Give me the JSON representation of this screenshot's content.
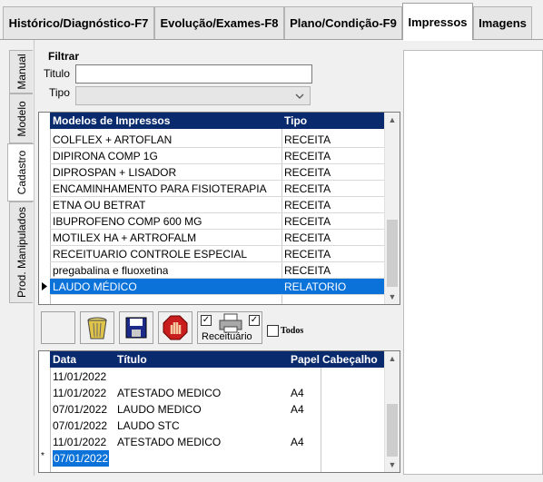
{
  "tabs": [
    {
      "label": "Histórico/Diagnóstico-F7"
    },
    {
      "label": "Evolução/Exames-F8"
    },
    {
      "label": "Plano/Condição-F9"
    },
    {
      "label": "Impressos",
      "active": true
    },
    {
      "label": "Imagens"
    }
  ],
  "side_tabs": [
    {
      "label": "Manual"
    },
    {
      "label": "Modelo"
    },
    {
      "label": "Cadastro",
      "active": true
    },
    {
      "label": "Prod. Manipulados"
    }
  ],
  "filter": {
    "group_label": "Filtrar",
    "title_label": "Titulo",
    "title_value": "",
    "type_label": "Tipo",
    "type_value": ""
  },
  "models_grid": {
    "headers": [
      "Modelos de Impressos",
      "Tipo"
    ],
    "rows": [
      {
        "name": "COLFLEX + ARTOFLAN",
        "type": "RECEITA"
      },
      {
        "name": "DIPIRONA COMP 1G",
        "type": "RECEITA"
      },
      {
        "name": "DIPROSPAN + LISADOR",
        "type": "RECEITA"
      },
      {
        "name": "ENCAMINHAMENTO PARA FISIOTERAPIA",
        "type": "RECEITA"
      },
      {
        "name": "ETNA OU BETRAT",
        "type": "RECEITA"
      },
      {
        "name": "IBUPROFENO COMP 600 MG",
        "type": "RECEITA"
      },
      {
        "name": "MOTILEX HA + ARTROFALM",
        "type": "RECEITA"
      },
      {
        "name": "RECEITUARIO CONTROLE ESPECIAL",
        "type": "RECEITA"
      },
      {
        "name": "pregabalina e fluoxetina",
        "type": "RECEITA"
      },
      {
        "name": "LAUDO MÉDICO",
        "type": "RELATORIO",
        "selected": true
      }
    ]
  },
  "toolbar": {
    "receituario_label": "Receituário",
    "todos_label": "Todos",
    "icons": [
      "blank-button",
      "trash-icon",
      "save-icon",
      "stop-hand-icon",
      "printer-icon"
    ]
  },
  "docs_grid": {
    "headers": [
      "Data",
      "Título",
      "Papel",
      "Cabeçalho"
    ],
    "rows": [
      {
        "date": "11/01/2022",
        "title": "",
        "paper": "",
        "header": ""
      },
      {
        "date": "11/01/2022",
        "title": "ATESTADO MEDICO",
        "paper": "A4",
        "header": ""
      },
      {
        "date": "07/01/2022",
        "title": "LAUDO MEDICO",
        "paper": "A4",
        "header": ""
      },
      {
        "date": "07/01/2022",
        "title": "LAUDO STC",
        "paper": "",
        "header": ""
      },
      {
        "date": "11/01/2022",
        "title": "ATESTADO MEDICO",
        "paper": "A4",
        "header": ""
      },
      {
        "date": "07/01/2022",
        "title": "",
        "paper": "",
        "header": "",
        "selected": true
      }
    ]
  },
  "colors": {
    "header_bg": "#0a2a6e",
    "selection": "#0a72d8"
  }
}
